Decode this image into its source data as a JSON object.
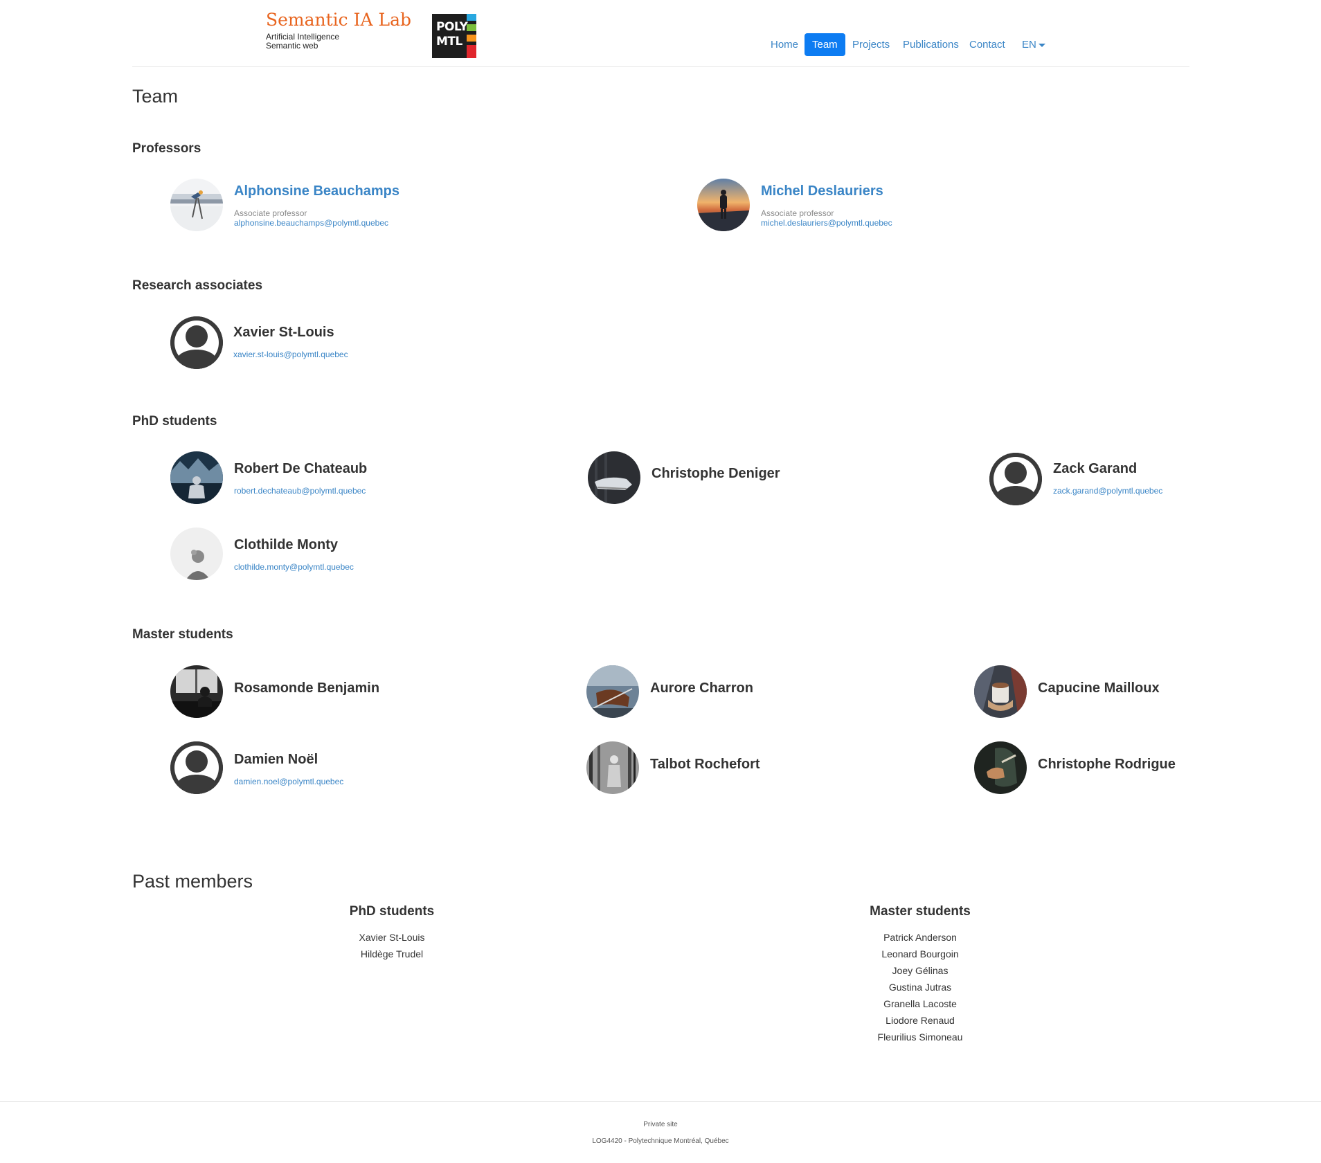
{
  "header": {
    "brand": "Semantic IA Lab",
    "subtitles": [
      "Artificial Intelligence",
      "Semantic web"
    ],
    "logo_lines": [
      "POLY",
      "MTL"
    ],
    "logo_colors": [
      "#29a8e0",
      "#7bbf3c",
      "#f7941d",
      "#e0262c"
    ],
    "nav": [
      {
        "label": "Home",
        "active": false
      },
      {
        "label": "Team",
        "active": true
      },
      {
        "label": "Projects",
        "active": false
      },
      {
        "label": "Publications",
        "active": false
      },
      {
        "label": "Contact",
        "active": false
      },
      {
        "label": "EN",
        "active": false,
        "dropdown": true
      }
    ]
  },
  "page_title": "Team",
  "sections": {
    "professors": {
      "title": "Professors",
      "people": [
        {
          "name": "Alphonsine Beauchamps",
          "role": "Associate professor",
          "email": "alphonsine.beauchamps@polymtl.quebec",
          "avatar": "snowy-landscape-photo"
        },
        {
          "name": "Michel Deslauriers",
          "role": "Associate professor",
          "email": "michel.deslauriers@polymtl.quebec",
          "avatar": "hiker-sunset-photo"
        }
      ]
    },
    "research_associates": {
      "title": "Research associates",
      "people": [
        {
          "name": "Xavier St-Louis",
          "email": "xavier.st-louis@polymtl.quebec",
          "avatar": "default-user-icon"
        }
      ]
    },
    "phd": {
      "title": "PhD students",
      "people": [
        {
          "name": "Robert De Chateaub",
          "email": "robert.dechateaub@polymtl.quebec",
          "avatar": "mountain-person-photo"
        },
        {
          "name": "Christophe Deniger",
          "avatar": "sneakers-photo"
        },
        {
          "name": "Zack Garand",
          "email": "zack.garand@polymtl.quebec",
          "avatar": "default-user-icon"
        },
        {
          "name": "Clothilde Monty",
          "email": "clothilde.monty@polymtl.quebec",
          "avatar": "grey-portrait-photo"
        }
      ]
    },
    "master": {
      "title": "Master students",
      "people": [
        {
          "name": "Rosamonde Benjamin",
          "avatar": "bw-window-photo"
        },
        {
          "name": "Aurore Charron",
          "avatar": "violin-photo"
        },
        {
          "name": "Capucine Mailloux",
          "avatar": "coffee-cup-photo"
        },
        {
          "name": "Damien Noël",
          "email": "damien.noel@polymtl.quebec",
          "avatar": "default-user-icon"
        },
        {
          "name": "Talbot Rochefort",
          "avatar": "bw-forest-photo"
        },
        {
          "name": "Christophe Rodrigue",
          "avatar": "dark-hands-photo"
        }
      ]
    }
  },
  "past": {
    "title": "Past members",
    "phd": {
      "title": "PhD students",
      "names": [
        "Xavier St-Louis",
        "Hildège Trudel"
      ]
    },
    "master": {
      "title": "Master students",
      "names": [
        "Patrick Anderson",
        "Leonard Bourgoin",
        "Joey Gélinas",
        "Gustina Jutras",
        "Granella Lacoste",
        "Liodore Renaud",
        "Fleurilius Simoneau"
      ]
    }
  },
  "footer": {
    "line1": "Private site",
    "line2": "LOG4420 - Polytechnique Montréal, Québec"
  }
}
